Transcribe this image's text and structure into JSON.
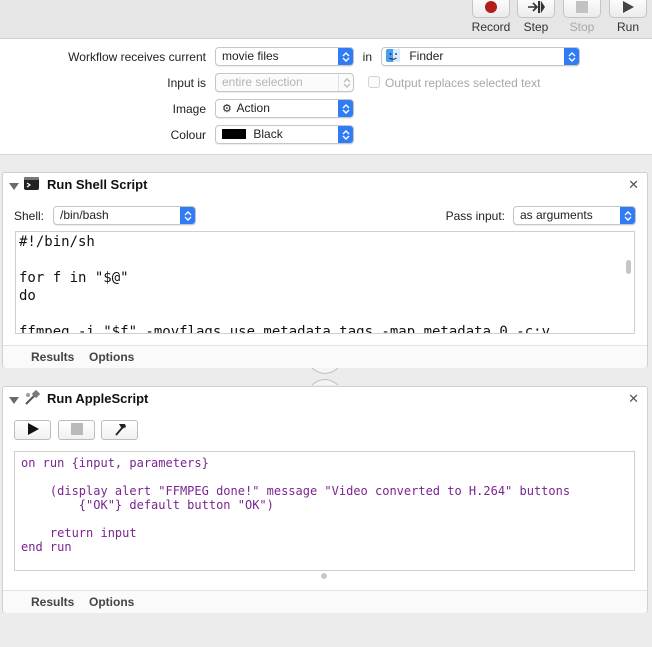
{
  "toolbar": {
    "record_label": "Record",
    "step_label": "Step",
    "stop_label": "Stop",
    "run_label": "Run"
  },
  "workflow": {
    "receives_label": "Workflow receives current",
    "receives_value": "movie files",
    "in_label": "in",
    "in_value": "Finder",
    "input_is_label": "Input is",
    "input_is_value": "entire selection",
    "output_replaces_label": "Output replaces selected text",
    "image_label": "Image",
    "image_value": "Action",
    "colour_label": "Colour",
    "colour_value": "Black"
  },
  "shell_action": {
    "title": "Run Shell Script",
    "shell_label": "Shell:",
    "shell_value": "/bin/bash",
    "pass_input_label": "Pass input:",
    "pass_input_value": "as arguments",
    "code": "#!/bin/sh\n\nfor f in \"$@\"\ndo\n\nffmpeg -i \"$f\" -movflags use_metadata_tags -map_metadata 0 -c:v",
    "results_tab": "Results",
    "options_tab": "Options"
  },
  "applescript_action": {
    "title": "Run AppleScript",
    "code": "on run {input, parameters}\n\n    (display alert \"FFMPEG done!\" message \"Video converted to H.264\" buttons\n        {\"OK\"} default button \"OK\")\n\n    return input\nend run",
    "results_tab": "Results",
    "options_tab": "Options"
  },
  "colors": {
    "accent": "#2f7cf6",
    "record_red": "#b51d1d",
    "applescript_purple": "#7a2590"
  },
  "icons": {
    "record": "record-icon",
    "step": "step-icon",
    "stop": "stop-icon",
    "run": "run-icon",
    "finder": "finder-icon",
    "action_gear": "gear-icon",
    "terminal": "terminal-icon",
    "script": "applescript-icon",
    "compile": "hammer-icon",
    "close": "close-icon"
  }
}
